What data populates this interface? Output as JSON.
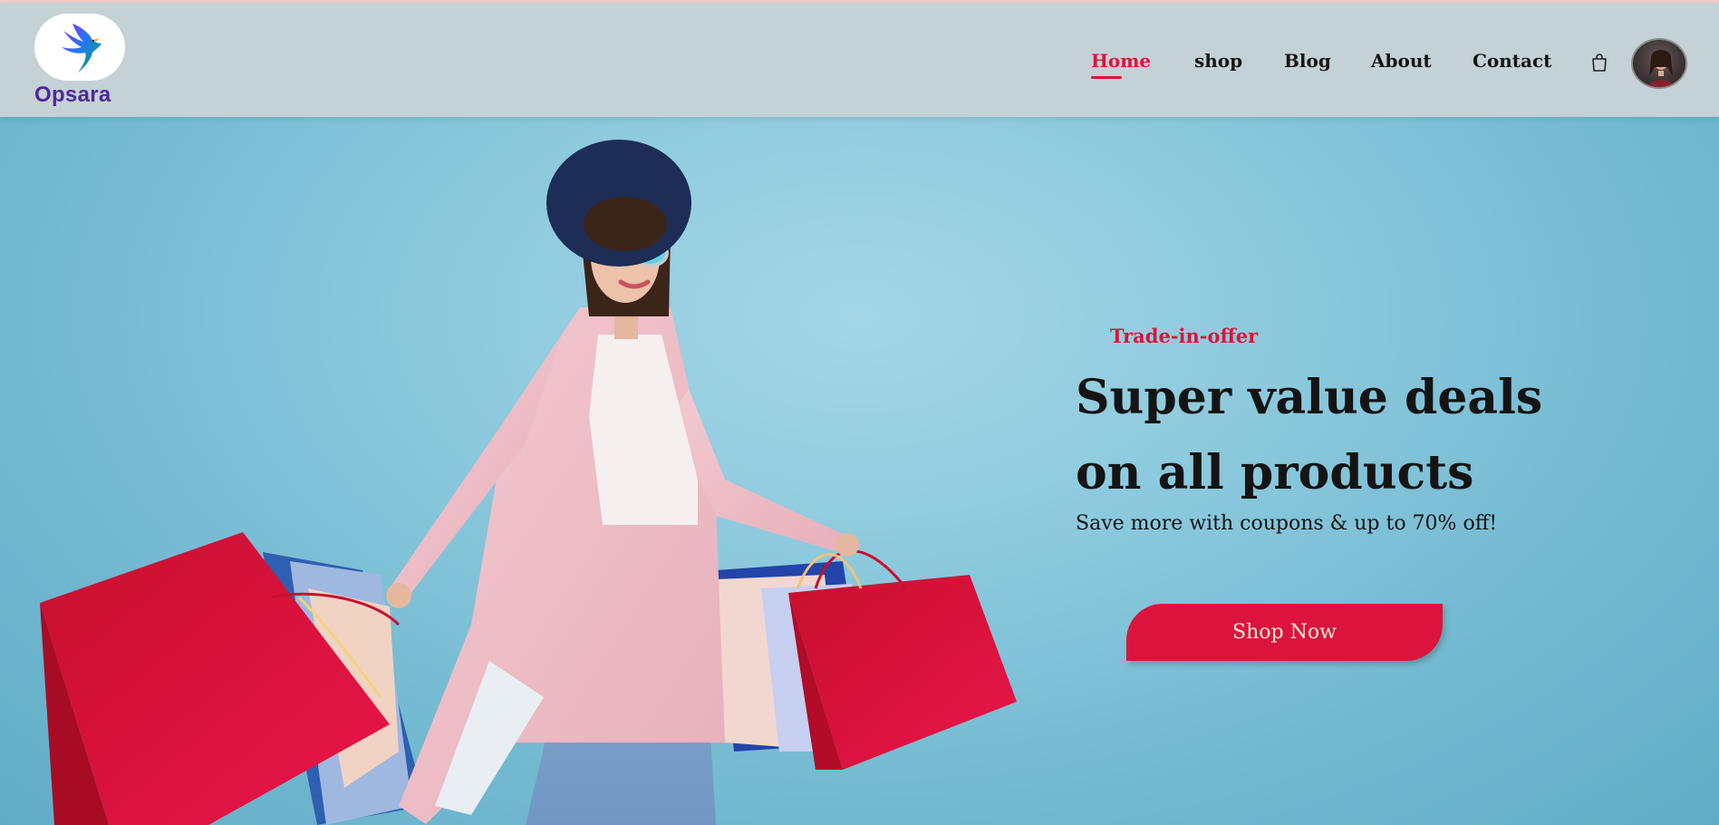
{
  "brand": {
    "name": "Opsara"
  },
  "nav": {
    "items": [
      {
        "label": "Home",
        "active": true
      },
      {
        "label": "shop",
        "active": false
      },
      {
        "label": "Blog",
        "active": false
      },
      {
        "label": "About",
        "active": false
      },
      {
        "label": "Contact",
        "active": false
      }
    ]
  },
  "icons": {
    "cart": "shopping-bag-icon",
    "profile": "user-avatar"
  },
  "hero": {
    "tag": "Trade-in-offer",
    "headline_line1": "Super value deals",
    "headline_line2": "on all products",
    "subline": "Save more with coupons & up to 70% off!",
    "cta_label": "Shop Now"
  },
  "colors": {
    "accent": "#dc143c",
    "header_bg": "#c4d1d5",
    "hero_bg": "#8cc9dd",
    "brand_text": "#5127a0",
    "cta_text": "#fde6d2"
  }
}
